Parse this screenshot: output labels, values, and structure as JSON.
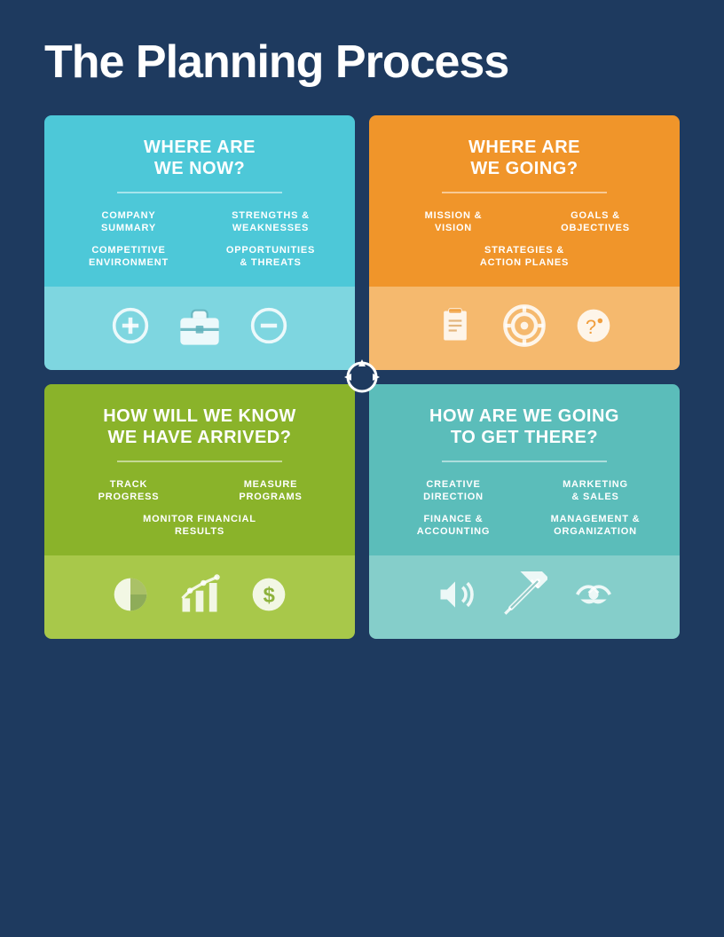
{
  "page": {
    "title": "The Planning Process",
    "background": "#1e3a5f"
  },
  "cards": [
    {
      "id": "card-1",
      "title": "WHERE ARE\nWE NOW?",
      "color_top": "#4dc8d8",
      "color_bottom": "#7ed6e0",
      "items": [
        "COMPANY\nSUMMARY",
        "STRENGTHS &\nWEAKNESSES",
        "COMPETITIVE\nENVIRONMENT",
        "OPPORTUNITIES\n& THREATS"
      ],
      "icons": [
        "plus",
        "briefcase",
        "minus"
      ]
    },
    {
      "id": "card-2",
      "title": "WHERE ARE\nWE GOING?",
      "color_top": "#f0952a",
      "color_bottom": "#f5b96e",
      "items": [
        "MISSION &\nVISION",
        "GOALS &\nOBJECTIVES",
        "STRATEGIES &\nACTION PLANES"
      ],
      "icons": [
        "clipboard",
        "target",
        "question"
      ]
    },
    {
      "id": "card-3",
      "title": "HOW WILL WE KNOW\nWE HAVE ARRIVED?",
      "color_top": "#8ab32a",
      "color_bottom": "#a8c84a",
      "items": [
        "TRACK\nPROGRESS",
        "MEASURE\nPROGRAMS",
        "MONITOR FINANCIAL\nRESULTS"
      ],
      "icons": [
        "pie-chart",
        "bar-chart",
        "money"
      ]
    },
    {
      "id": "card-4",
      "title": "HOW ARE WE GOING\nTO GET THERE?",
      "color_top": "#5bbdba",
      "color_bottom": "#85ceca",
      "items": [
        "CREATIVE\nDIRECTION",
        "MARKETING\n& SALES",
        "FINANCE &\nACCOUNTING",
        "MANAGEMENT &\nORGANIZATION"
      ],
      "icons": [
        "megaphone",
        "tools",
        "handshake"
      ]
    }
  ],
  "center": {
    "icon": "refresh"
  }
}
